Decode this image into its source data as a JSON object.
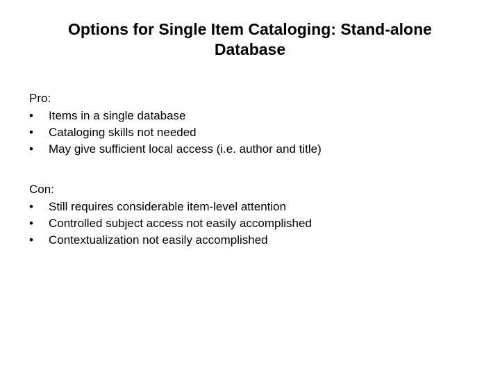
{
  "title": "Options for Single Item Cataloging: Stand-alone Database",
  "sections": [
    {
      "heading": "Pro:",
      "items": [
        "Items in a single database",
        "Cataloging skills not needed",
        "May give sufficient local access (i.e. author and title)"
      ]
    },
    {
      "heading": "Con:",
      "items": [
        "Still requires considerable item-level attention",
        "Controlled subject access not easily accomplished",
        "Contextualization not easily accomplished"
      ]
    }
  ],
  "bullet_char": "•"
}
